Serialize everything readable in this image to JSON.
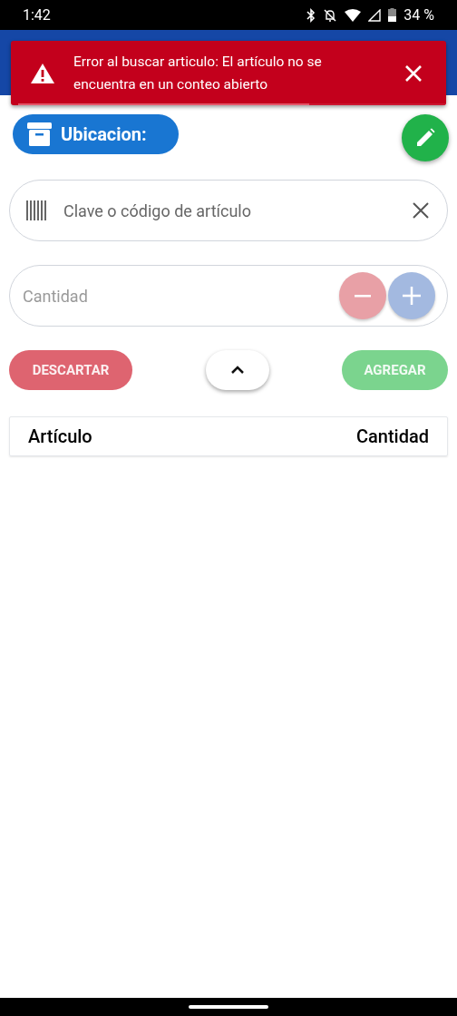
{
  "status_bar": {
    "time": "1:42",
    "battery": "34 %"
  },
  "toast": {
    "message": "Error al buscar articulo: El artículo no se encuentra en un conteo abierto",
    "level": 0.68
  },
  "location": {
    "label": "Ubicacion:"
  },
  "search": {
    "placeholder": "Clave o código de artículo"
  },
  "quantity": {
    "placeholder": "Cantidad",
    "disabled": true
  },
  "actions": [
    {
      "label": "DESCARTAR",
      "kind": "discard",
      "disabled": true
    },
    {
      "kind": "toggle",
      "disabled": false
    },
    {
      "label": "AGREGAR",
      "kind": "add",
      "disabled": true
    }
  ],
  "table": {
    "columns": [
      "Artículo",
      "Cantidad"
    ]
  }
}
